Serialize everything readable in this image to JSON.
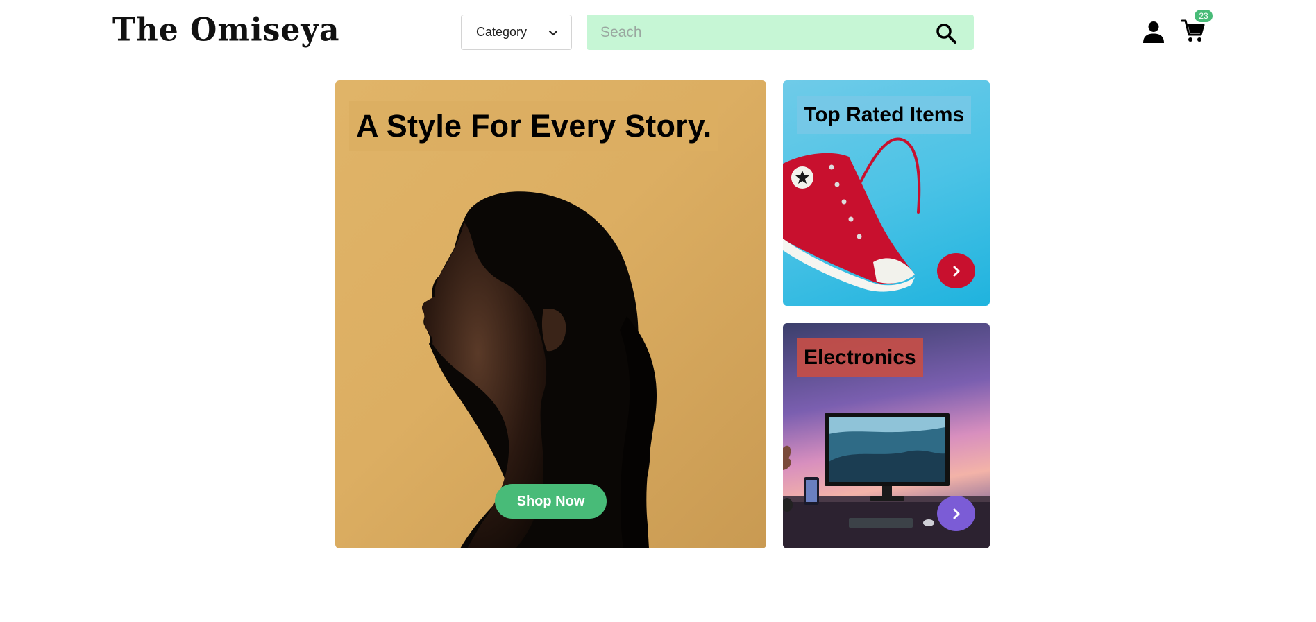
{
  "header": {
    "logo": "The Omiseya",
    "category_label": "Category",
    "search_placeholder": "Seach",
    "cart_count": "23"
  },
  "hero": {
    "title": "A Style For Every Story.",
    "button_label": "Shop Now"
  },
  "cards": [
    {
      "title": "Top Rated Items"
    },
    {
      "title": "Electronics"
    }
  ],
  "colors": {
    "accent_green": "#48bb78",
    "search_bg": "#c6f6d5",
    "hero_bg": "#dcae62",
    "top_rated_arrow": "#c8102e",
    "electronics_arrow": "#7b5cd6"
  },
  "icons": [
    "chevron-down-icon",
    "search-icon",
    "user-icon",
    "cart-icon",
    "chevron-right-icon"
  ]
}
